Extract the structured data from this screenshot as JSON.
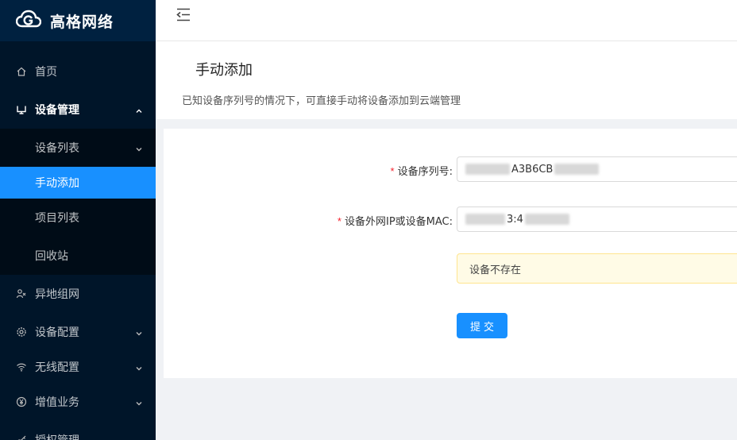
{
  "app": {
    "title": "高格网络"
  },
  "sidebar": {
    "items": [
      {
        "label": "首页",
        "icon": "home-icon"
      },
      {
        "label": "设备管理",
        "icon": "monitor-icon",
        "expanded": true,
        "children": [
          {
            "label": "设备列表",
            "has_arrow": true
          },
          {
            "label": "手动添加",
            "selected": true
          },
          {
            "label": "项目列表"
          },
          {
            "label": "回收站"
          }
        ]
      },
      {
        "label": "异地组网",
        "icon": "network-icon"
      },
      {
        "label": "设备配置",
        "icon": "settings-icon"
      },
      {
        "label": "无线配置",
        "icon": "wifi-icon"
      },
      {
        "label": "增值业务",
        "icon": "yen-icon"
      },
      {
        "label": "授权管理",
        "icon": "key-icon"
      }
    ]
  },
  "page": {
    "title": "手动添加",
    "description": "已知设备序列号的情况下，可直接手动将设备添加到云端管理"
  },
  "form": {
    "serial": {
      "label": "设备序列号:",
      "value_visible": "A3B6CB"
    },
    "ipmac": {
      "label": "设备外网IP或设备MAC:",
      "value_visible": "3:4"
    },
    "alert": "设备不存在",
    "submit_label": "提交"
  },
  "colors": {
    "sidebar_bg": "#001529",
    "primary": "#1890ff",
    "alert_bg": "#fffbe6",
    "required": "#f5222d"
  }
}
